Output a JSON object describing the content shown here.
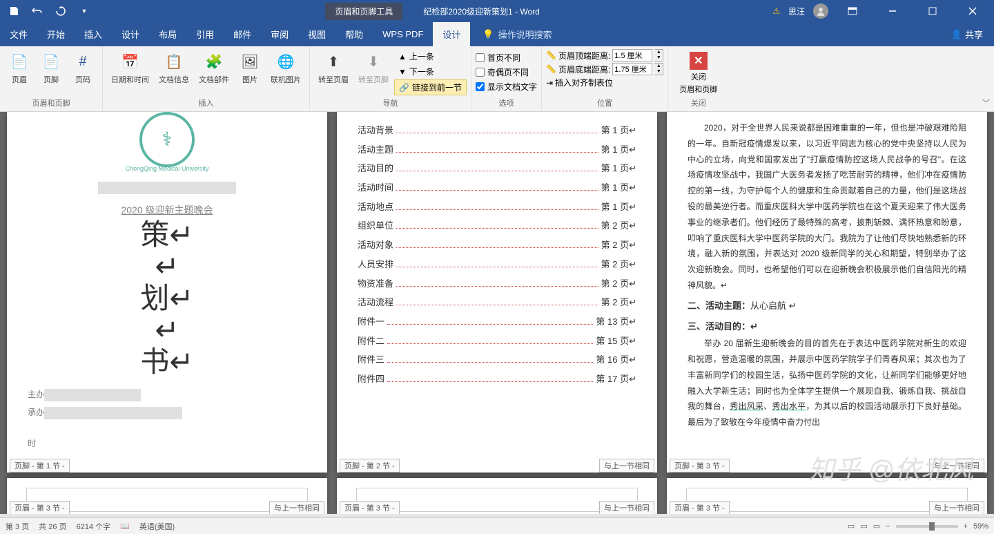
{
  "titlebar": {
    "contextTab": "页眉和页脚工具",
    "docTitle": "纪检部2020级迎新策划1  -  Word",
    "userLabel": "思汪"
  },
  "tabs": {
    "file": "文件",
    "home": "开始",
    "insert": "插入",
    "design": "设计",
    "layout": "布局",
    "references": "引用",
    "mailings": "邮件",
    "review": "审阅",
    "view": "视图",
    "help": "帮助",
    "wps": "WPS PDF",
    "hfDesign": "设计",
    "tellMe": "操作说明搜索",
    "share": "共享"
  },
  "ribbon": {
    "g1": {
      "label": "页眉和页脚",
      "header": "页眉",
      "footer": "页脚",
      "pageNum": "页码"
    },
    "g2": {
      "label": "插入",
      "datetime": "日期和时间",
      "docInfo": "文档信息",
      "quickParts": "文档部件",
      "picture": "图片",
      "onlinePic": "联机图片"
    },
    "g3": {
      "label": "导航",
      "gotoHeader": "转至页眉",
      "gotoFooter": "转至页脚",
      "prev": "上一条",
      "next": "下一条",
      "linkPrev": "链接到前一节"
    },
    "g4": {
      "label": "选项",
      "diffFirst": "首页不同",
      "diffOddEven": "奇偶页不同",
      "showText": "显示文档文字"
    },
    "g5": {
      "label": "位置",
      "topDist": "页眉顶端距离:",
      "topVal": "1.5 厘米",
      "botDist": "页眉底端距离:",
      "botVal": "1.75 厘米",
      "alignTab": "插入对齐制表位"
    },
    "g6": {
      "label": "关闭",
      "close": "关闭",
      "close2": "页眉和页脚"
    }
  },
  "page1": {
    "uniRing": "ChongQing Medical University",
    "subtitle": "2020 级迎新主题晚会",
    "char1": "策↵",
    "char2": "↵",
    "char3": "划↵",
    "char4": "↵",
    "char5": "书↵",
    "host": "主办",
    "org": "承办",
    "time": "时",
    "footerTag": "页脚 - 第 1 节 -"
  },
  "page2": {
    "toc": [
      {
        "t": "活动背景",
        "p": "第 1 页↵"
      },
      {
        "t": "活动主题",
        "p": "第 1 页↵"
      },
      {
        "t": "活动目的",
        "p": "第 1 页↵"
      },
      {
        "t": "活动时间",
        "p": "第 1 页↵"
      },
      {
        "t": "活动地点",
        "p": "第 1 页↵"
      },
      {
        "t": "组织单位",
        "p": "第 2 页↵"
      },
      {
        "t": "活动对象",
        "p": "第 2 页↵"
      },
      {
        "t": "人员安排",
        "p": "第 2 页↵"
      },
      {
        "t": "物资准备",
        "p": "第 2 页↵"
      },
      {
        "t": "活动流程",
        "p": "第 2 页↵"
      },
      {
        "t": "附件一",
        "p": "第 13 页↵"
      },
      {
        "t": "附件二",
        "p": "第 15 页↵"
      },
      {
        "t": "附件三",
        "p": "第 16 页↵"
      },
      {
        "t": "附件四",
        "p": "第 17 页↵"
      }
    ],
    "footerTag": "页脚 - 第 2 节 -",
    "sameAsPrev": "与上一节相同"
  },
  "page3": {
    "p1": "2020，对于全世界人民来说都是困难重重的一年，但也是冲破艰难险阻的一年。自新冠疫情爆发以来，以习近平同志为核心的党中央坚持以人民为中心的立场，向党和国家发出了\"打赢疫情防控这场人民战争的号召\"。在这场疫情攻坚战中，我国广大医务者发扬了吃苦耐劳的精神，他们冲在疫情防控的第一线，为守护每个人的健康和生命贡献着自己的力量，他们是这场战役的最美逆行者。而重庆医科大学中医药学院也在这个夏天迎来了伟大医务事业的继承者们。他们经历了最特殊的高考，披荆斩棘、满怀热意和盼意，叩响了重庆医科大学中医药学院的大门。我院为了让他们尽快地熟悉新的环境，融入新的氛围，并表达对 2020 级新同学的关心和期望，特别举办了这次迎新晚会。同时，也希望他们可以在迎新晚会积极展示他们自信阳光的精神风貌。↵",
    "h2": "二、活动主题：",
    "h2v": "从心启航 ↵",
    "h3": "三、活动目的：↵",
    "p2a": "举办 20 届新生迎新晚会的目的首先在于表达中医药学院对新生的欢迎和祝愿，营造温暖的氛围，并展示中医药学院学子们青春风采；其次也为了丰富新同学们的校园生活，弘扬中医药学院的文化，让新同学们能够更好地融入大学新生活；同时也为全体学生提供一个展现自我、锻炼自我、挑战自我的舞台，",
    "u1": "秀出风采",
    "comma": "、",
    "u2": "秀出水平",
    "p2b": "，为其以后的校园活动展示打下良好基础。最后为了致敬在今年疫情中奋力付出",
    "footerTag": "页脚 - 第 3 节 -",
    "sameAsPrev": "与上一节相同"
  },
  "pageRow2": {
    "h1": "页眉 - 第 3 节 -",
    "same": "与上一节相同",
    "h2": "页眉 - 第 3 节 -",
    "h3": "页眉 - 第 3 节 -"
  },
  "status": {
    "page": "第 3 页",
    "total": "共 26 页",
    "words": "6214 个字",
    "lang": "英语(美国)",
    "zoom": "59%"
  },
  "watermark": "知乎 @依北风"
}
